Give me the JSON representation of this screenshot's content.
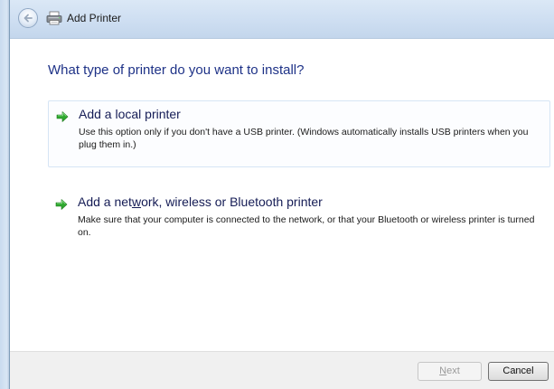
{
  "window": {
    "title": "Add Printer"
  },
  "heading": "What type of printer do you want to install?",
  "options": [
    {
      "title": "Add a local printer",
      "description": "Use this option only if you don't have a USB printer. (Windows automatically installs USB printers when you plug them in.)",
      "icon": "green-arrow-icon"
    },
    {
      "title_parts": [
        "Add a net",
        "w",
        "ork, wireless or Bluetooth printer"
      ],
      "description": "Make sure that your computer is connected to the network, or that your Bluetooth or wireless printer is turned on.",
      "icon": "green-arrow-icon"
    }
  ],
  "footer": {
    "next_label_parts": [
      "N",
      "ext"
    ],
    "cancel_label": "Cancel",
    "next_enabled": false
  },
  "colors": {
    "heading": "#1e3287",
    "option_title": "#151c55",
    "arrow_green": "#2ea82e"
  }
}
